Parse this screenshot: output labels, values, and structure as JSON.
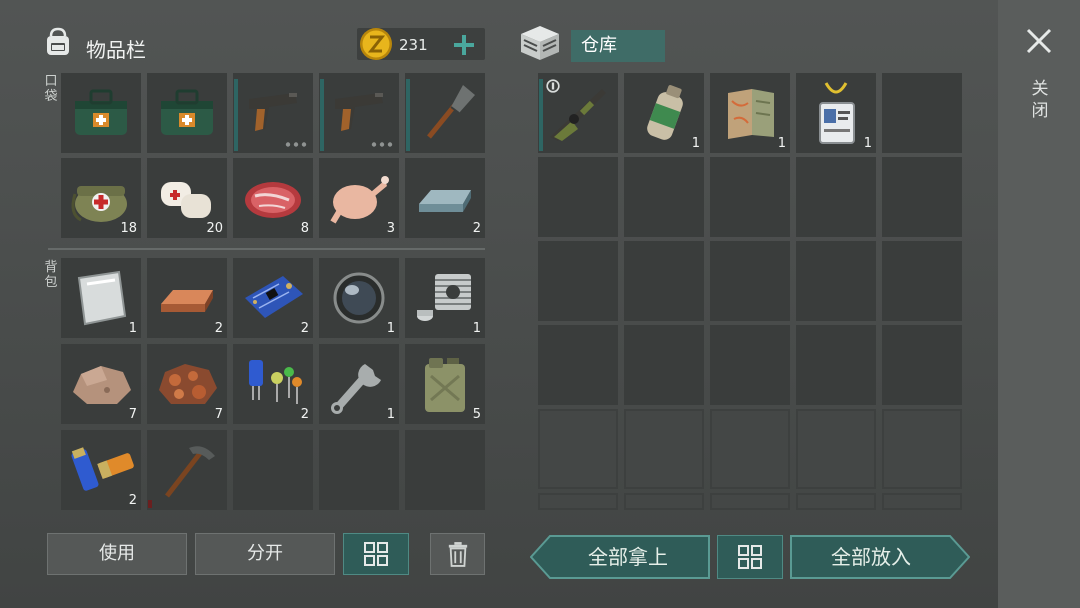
{
  "inventory": {
    "title": "物品栏",
    "pocket_label": "口袋",
    "backpack_label": "背包",
    "coins": "231"
  },
  "storage": {
    "tab_label": "仓库"
  },
  "close": {
    "label": "关闭"
  },
  "pocket_items": [
    {
      "icon": "medkit-case-icon",
      "qty": ""
    },
    {
      "icon": "medkit-case-icon",
      "qty": ""
    },
    {
      "icon": "pistol-icon",
      "qty": ""
    },
    {
      "icon": "pistol-icon",
      "qty": ""
    },
    {
      "icon": "shovel-icon",
      "qty": ""
    },
    {
      "icon": "first-aid-bag-icon",
      "qty": "18"
    },
    {
      "icon": "bandage-icon",
      "qty": "20"
    },
    {
      "icon": "raw-meat-icon",
      "qty": "8"
    },
    {
      "icon": "raw-chicken-icon",
      "qty": "3"
    },
    {
      "icon": "iron-ingot-icon",
      "qty": "2"
    }
  ],
  "backpack_items": [
    {
      "icon": "aluminum-sheet-icon",
      "qty": "1"
    },
    {
      "icon": "copper-ingot-icon",
      "qty": "2"
    },
    {
      "icon": "circuit-board-icon",
      "qty": "2"
    },
    {
      "icon": "lens-icon",
      "qty": "1"
    },
    {
      "icon": "engine-cylinder-icon",
      "qty": "1"
    },
    {
      "icon": "stone-ore-icon",
      "qty": "7"
    },
    {
      "icon": "copper-ore-icon",
      "qty": "7"
    },
    {
      "icon": "electronic-components-icon",
      "qty": "2"
    },
    {
      "icon": "wrench-icon",
      "qty": "1"
    },
    {
      "icon": "fuel-canister-icon",
      "qty": "5"
    },
    {
      "icon": "batteries-icon",
      "qty": "2"
    },
    {
      "icon": "pickaxe-icon",
      "qty": ""
    },
    {
      "icon": "",
      "qty": ""
    },
    {
      "icon": "",
      "qty": ""
    },
    {
      "icon": "",
      "qty": ""
    }
  ],
  "storage_items": [
    {
      "icon": "shotgun-icon",
      "qty": ""
    },
    {
      "icon": "gas-cylinder-icon",
      "qty": "1"
    },
    {
      "icon": "map-icon",
      "qty": "1"
    },
    {
      "icon": "id-badge-icon",
      "qty": "1"
    },
    {
      "icon": "",
      "qty": ""
    }
  ],
  "buttons": {
    "use": "使用",
    "split": "分开",
    "take_all": "全部拿上",
    "put_all": "全部放入"
  },
  "colors": {
    "accent_teal": "#2f5c58",
    "background": "#4a4d4c",
    "cell": "#3a3d3c",
    "coin_gold": "#e8b51c"
  }
}
